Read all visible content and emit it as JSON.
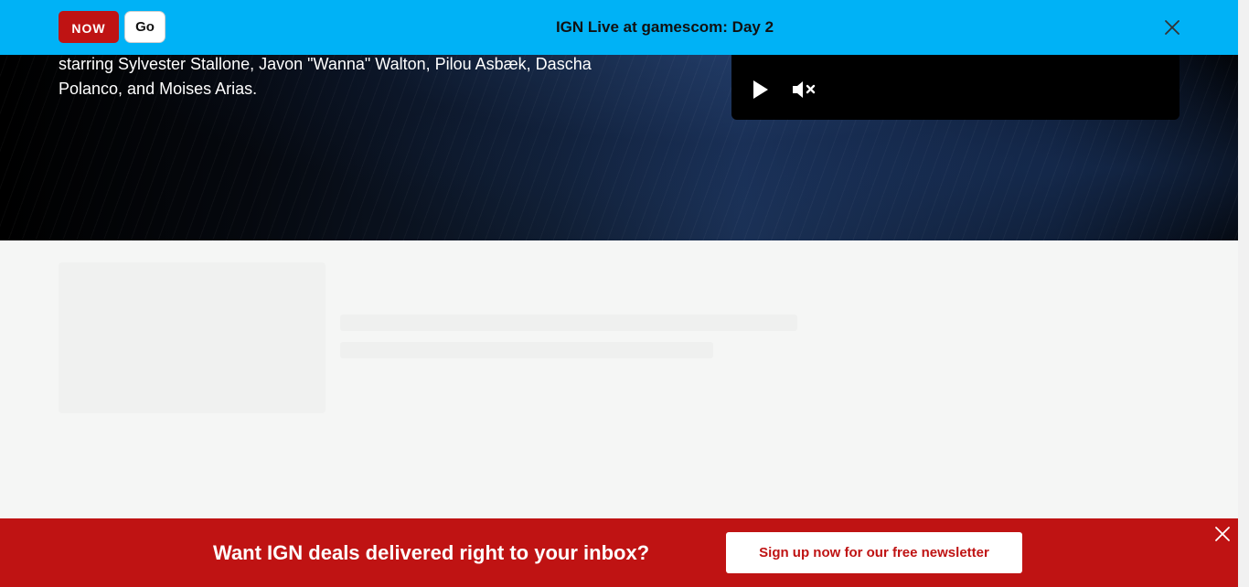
{
  "live_banner": {
    "badge": "NOW",
    "go_label": "Go",
    "title": "IGN Live at gamescom: Day 2",
    "close_icon": "close-icon",
    "background": "#00b2f6",
    "badge_color": "#bf1313"
  },
  "hero": {
    "description": "starring Sylvester Stallone, Javon \"Wanna\" Walton, Pilou Asbæk, Dascha Polanco, and Moises Arias."
  },
  "video_player": {
    "play_icon": "play-icon",
    "mute_icon": "volume-muted-icon"
  },
  "newsletter": {
    "prompt": "Want IGN deals delivered right to your inbox?",
    "cta_label": "Sign up now for our free newsletter",
    "close_icon": "close-icon",
    "background": "#bf1313"
  }
}
